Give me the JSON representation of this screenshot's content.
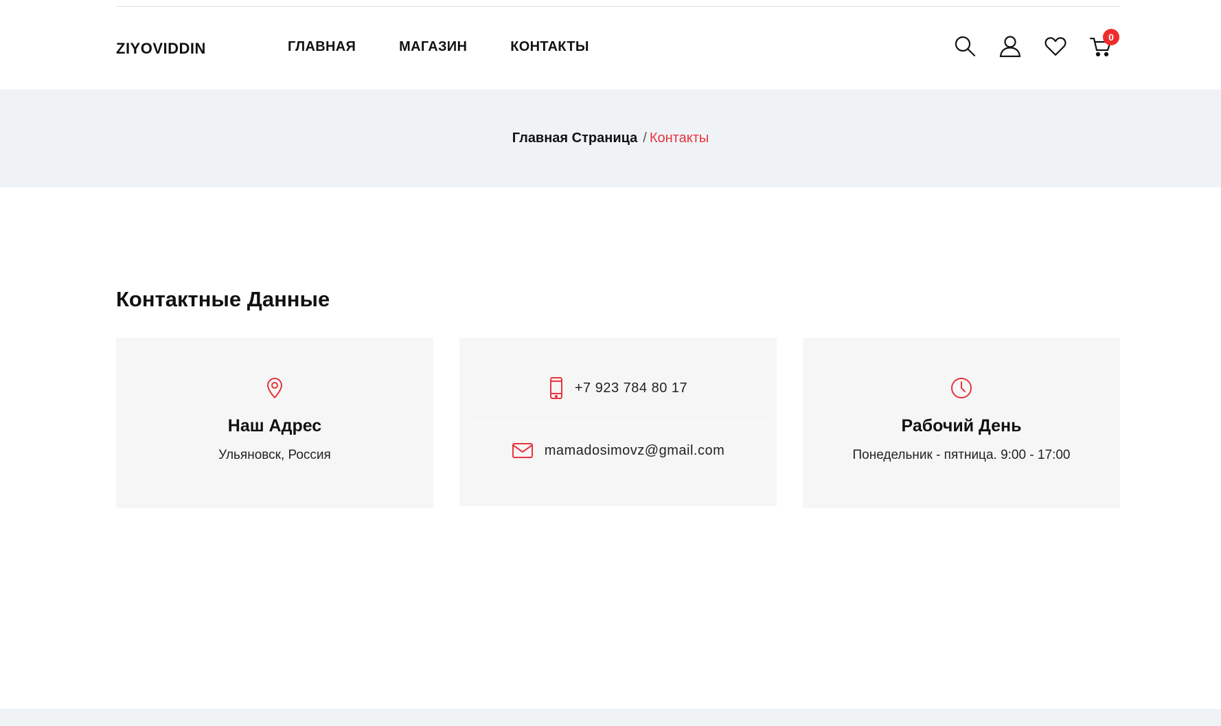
{
  "header": {
    "logo": "ZIYOVIDDIN",
    "nav": [
      {
        "label": "ГЛАВНАЯ"
      },
      {
        "label": "МАГАЗИН"
      },
      {
        "label": "КОНТАКТЫ"
      }
    ],
    "icons": [
      "search-icon",
      "user-icon",
      "heart-icon",
      "cart-icon"
    ],
    "cart_count": "0"
  },
  "breadcrumb": {
    "home": "Главная Страница",
    "separator": "/",
    "current": "Контакты"
  },
  "contact": {
    "title": "Контактные Данные",
    "address": {
      "heading": "Наш Адрес",
      "text": "Ульяновск, Россия"
    },
    "phone": "+7 923 784 80 17",
    "email": "mamadosimovz@gmail.com",
    "hours": {
      "heading": "Рабочий День",
      "text": "Понедельник - пятница. 9:00 - 17:00"
    }
  },
  "colors": {
    "accent": "#e8333a",
    "band": "#f0f3f6",
    "card": "#f6f6f6"
  }
}
